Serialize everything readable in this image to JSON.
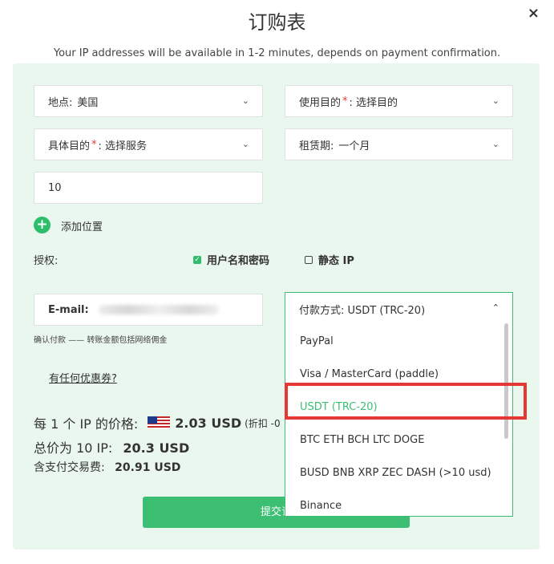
{
  "header": {
    "title": "订购表",
    "close_glyph": "×",
    "subtitle": "Your IP addresses will be available in 1-2 minutes, depends on payment confirmation."
  },
  "form": {
    "location": {
      "label": "地点:",
      "value": "美国"
    },
    "purpose": {
      "label": "使用目的",
      "value": ": 选择目的"
    },
    "service": {
      "label": "具体目的",
      "value": ": 选择服务"
    },
    "rental": {
      "label": "租赁期:",
      "value": "一个月"
    },
    "quantity": "10",
    "add_location": "添加位置",
    "auth_label": "授权:",
    "auth_options": [
      {
        "label": "用户名和密码",
        "checked": true
      },
      {
        "label": "静态 IP",
        "checked": false
      }
    ],
    "email_label": "E-mail:",
    "note": "确认付款 —— 转账金额包括网络佣金",
    "coupon": "有任何优惠券?"
  },
  "pricing": {
    "per_ip_label": "每 1 个 IP 的价格:",
    "per_ip_value": "2.03 USD",
    "discount": "(折扣 -0",
    "total_label": "总价为 10 IP:",
    "total_value": "20.3 USD",
    "fee_label": "含支付交易费:",
    "fee_value": "20.91 USD"
  },
  "submit": "提交订",
  "payment": {
    "label": "付款方式: USDT (TRC-20)",
    "options": [
      "PayPal",
      "Visa / MasterCard (paddle)",
      "USDT (TRC-20)",
      "BTC ETH BCH LTC DOGE",
      "BUSD BNB XRP ZEC DASH (>10 usd)",
      "Binance"
    ],
    "selected_index": 2
  },
  "colors": {
    "accent": "#3cbf72",
    "panel": "#eaf7ee",
    "highlight": "#e53935"
  }
}
